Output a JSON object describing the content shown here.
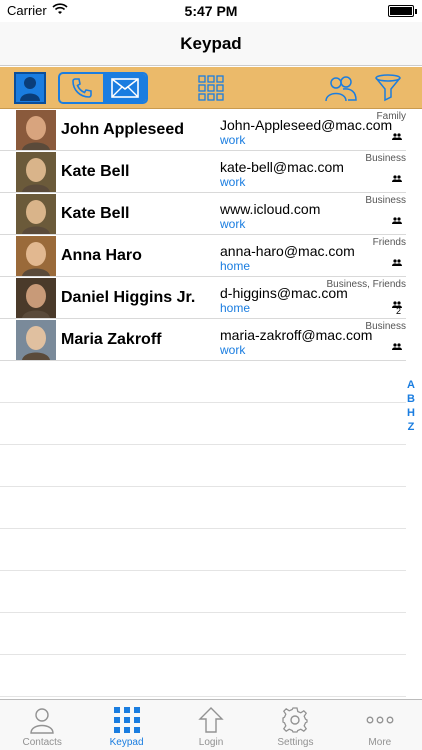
{
  "status": {
    "carrier": "Carrier",
    "time": "5:47 PM"
  },
  "nav": {
    "title": "Keypad"
  },
  "contacts": [
    {
      "name": "John Appleseed",
      "email": "John-Appleseed@mac.com",
      "label": "work",
      "group": "Family",
      "group_count": ""
    },
    {
      "name": "Kate Bell",
      "email": "kate-bell@mac.com",
      "label": "work",
      "group": "Business",
      "group_count": ""
    },
    {
      "name": "Kate Bell",
      "email": "www.icloud.com",
      "label": "work",
      "group": "Business",
      "group_count": ""
    },
    {
      "name": "Anna Haro",
      "email": "anna-haro@mac.com",
      "label": "home",
      "group": "Friends",
      "group_count": ""
    },
    {
      "name": "Daniel Higgins Jr.",
      "email": "d-higgins@mac.com",
      "label": "home",
      "group": "Business, Friends",
      "group_count": "2"
    },
    {
      "name": "Maria Zakroff",
      "email": "maria-zakroff@mac.com",
      "label": "work",
      "group": "Business",
      "group_count": ""
    }
  ],
  "index": [
    "A",
    "B",
    "H",
    "Z"
  ],
  "tabs": [
    {
      "label": "Contacts",
      "icon": "person-icon"
    },
    {
      "label": "Keypad",
      "icon": "keypad-icon"
    },
    {
      "label": "Login",
      "icon": "upload-arrow-icon"
    },
    {
      "label": "Settings",
      "icon": "gear-icon"
    },
    {
      "label": "More",
      "icon": "more-dots-icon"
    }
  ],
  "colors": {
    "accent": "#1a7de0",
    "toolbar": "#ebba6a"
  }
}
